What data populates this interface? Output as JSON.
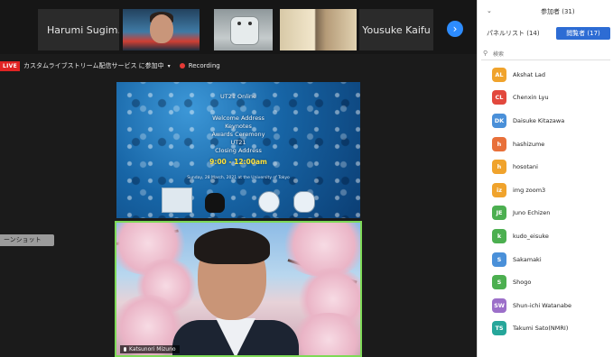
{
  "video_strip": {
    "tiles": [
      {
        "name": "Harumi Sugim..."
      },
      {
        "name": ""
      },
      {
        "name": ""
      },
      {
        "name": ""
      },
      {
        "name": "Yousuke Kaifu"
      }
    ],
    "next_icon": "chevron-right-icon"
  },
  "livebar": {
    "badge": "LIVE",
    "stream_text": "カスタムライブストリーム配信サービス に参加中",
    "recording_label": "Recording"
  },
  "snapshot_label": "ーンショット",
  "slide": {
    "line1": "UT21 Online",
    "line2": "Welcome Address",
    "line3": "Keynotes",
    "line4": "Awards Ceremony",
    "line5": "UT21",
    "line6": "Closing Address",
    "time": "9:00 - 12:00am",
    "fine": "Sunday, 28 March, 2021 at the University of Tokyo"
  },
  "speaker": {
    "name": "Katsunori Mizuno"
  },
  "panel": {
    "collapse_icon": "chevron-down-icon",
    "title": "参加者 (31)",
    "tab_panelists": "パネルリスト (14)",
    "tab_attendees": "閲覧者 (17)",
    "search_placeholder": "検索",
    "participants": [
      {
        "initials": "AL",
        "name": "Akshat Lad",
        "color": "#f0a32c"
      },
      {
        "initials": "CL",
        "name": "Chenxin Lyu",
        "color": "#e2483d"
      },
      {
        "initials": "DK",
        "name": "Daisuke Kitazawa",
        "color": "#4a90d9"
      },
      {
        "initials": "h",
        "name": "hashizume",
        "color": "#e8703a"
      },
      {
        "initials": "h",
        "name": "hosotani",
        "color": "#f0a32c"
      },
      {
        "initials": "iz",
        "name": "img zoom3",
        "color": "#f0a32c"
      },
      {
        "initials": "JE",
        "name": "Juno Echizen",
        "color": "#4caf50"
      },
      {
        "initials": "k",
        "name": "kudo_eisuke",
        "color": "#4caf50"
      },
      {
        "initials": "S",
        "name": "Sakamaki",
        "color": "#4a90d9"
      },
      {
        "initials": "S",
        "name": "Shogo",
        "color": "#4caf50"
      },
      {
        "initials": "SW",
        "name": "Shun-ichi Watanabe",
        "color": "#9c6fc9"
      },
      {
        "initials": "TS",
        "name": "Takumi Sato(NMRI)",
        "color": "#26a69a"
      }
    ]
  }
}
